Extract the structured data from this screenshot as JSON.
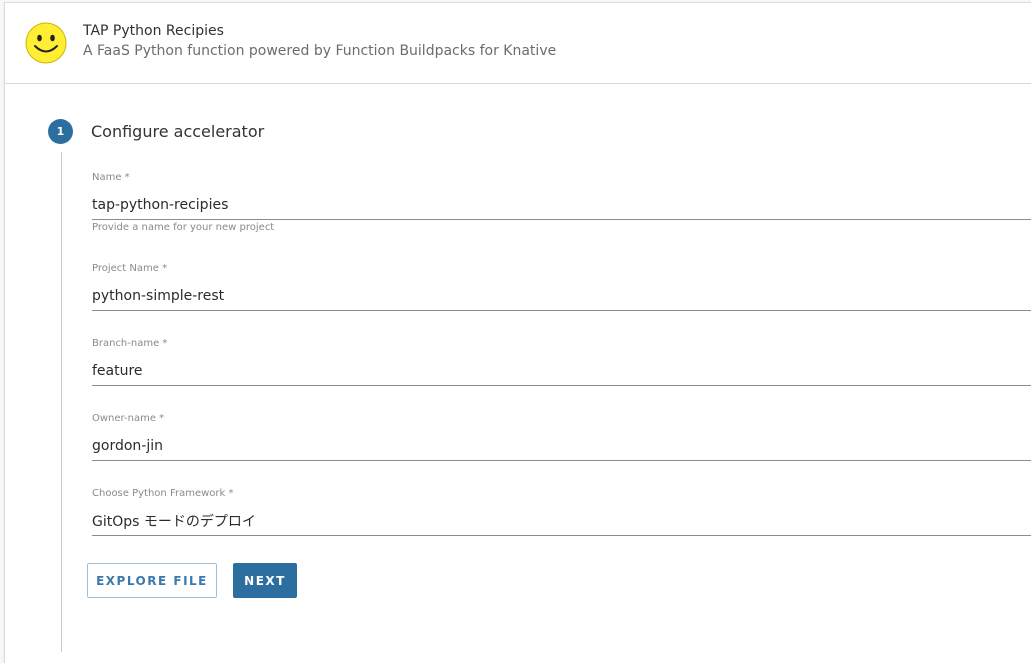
{
  "header": {
    "logo_icon": "smiley-face-icon",
    "title": "TAP Python Recipies",
    "subtitle": "A FaaS Python function powered by Function Buildpacks for Knative"
  },
  "step": {
    "number": "1",
    "title": "Configure accelerator"
  },
  "fields": [
    {
      "label": "Name *",
      "value": "tap-python-recipies",
      "help": "Provide a name for your new project"
    },
    {
      "label": "Project Name *",
      "value": "python-simple-rest"
    },
    {
      "label": "Branch-name *",
      "value": "feature"
    },
    {
      "label": "Owner-name *",
      "value": "gordon-jin"
    },
    {
      "label": "Choose Python Framework *",
      "value": "GitOps モードのデプロイ"
    }
  ],
  "buttons": {
    "explore_file": "EXPLORE FILE",
    "next": "NEXT"
  },
  "colors": {
    "accent": "#2d6ea1",
    "logo_yellow": "#ffee33"
  }
}
